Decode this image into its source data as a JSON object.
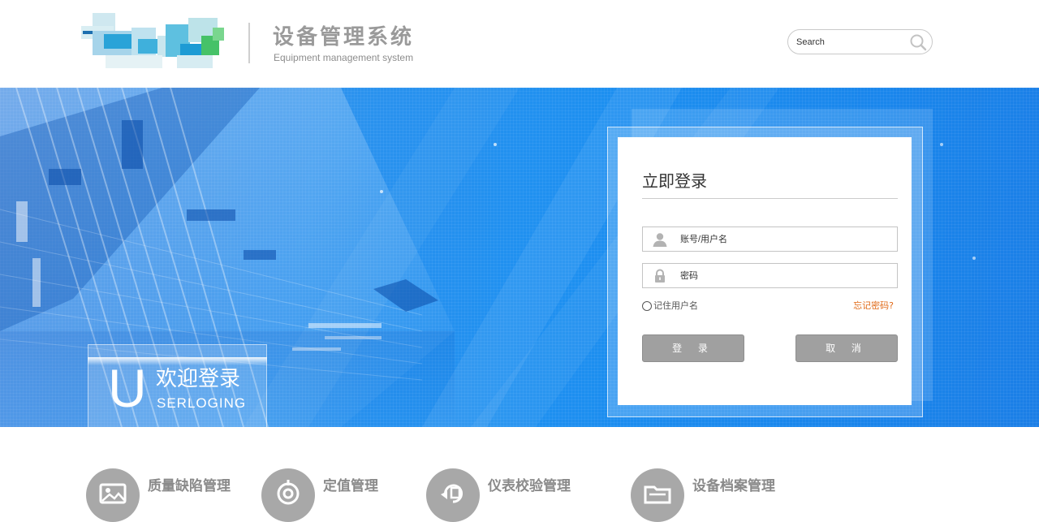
{
  "header": {
    "title_cn": "设备管理系统",
    "title_en": "Equipment management system",
    "logo_icon": "blurred-logo-image",
    "search": {
      "placeholder": "Search",
      "icon": "search-icon"
    }
  },
  "banner": {
    "welcome": {
      "letter": "U",
      "title": "欢迎登录",
      "subtitle": "SERLOGING"
    }
  },
  "login": {
    "title": "立即登录",
    "username_placeholder": "账号/用户名",
    "password_placeholder": "密码",
    "remember_label": "记住用户名",
    "forgot_label": "忘记密码?",
    "login_button": "登 录",
    "cancel_button": "取 消"
  },
  "modules": [
    {
      "label": "质量缺陷管理",
      "icon": "image-icon"
    },
    {
      "label": "定值管理",
      "icon": "target-icon"
    },
    {
      "label": "仪表校验管理",
      "icon": "refresh-icon"
    },
    {
      "label": "设备档案管理",
      "icon": "folder-icon"
    }
  ],
  "colors": {
    "banner_blue": "#1d8ff0",
    "button_gray": "#a0a0a0",
    "forgot_orange": "#e06a18",
    "title_gray": "#9a9a9a"
  }
}
